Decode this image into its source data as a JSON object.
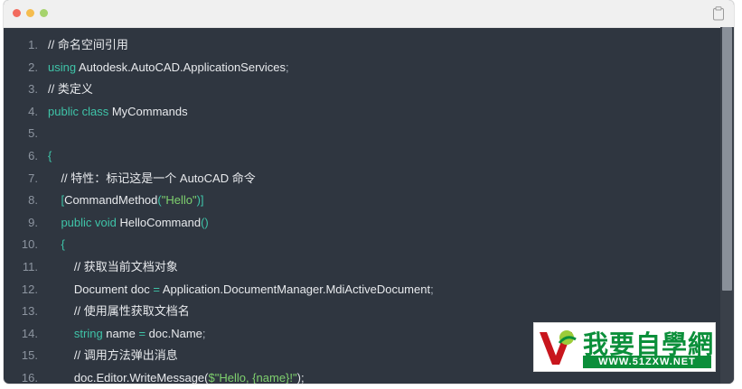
{
  "window": {
    "controls": [
      "close",
      "minimize",
      "maximize"
    ],
    "copy_icon": "clipboard-icon"
  },
  "code": {
    "lines": [
      {
        "n": "1.",
        "parts": [
          {
            "t": "// 命名空间引用",
            "c": "cm"
          }
        ]
      },
      {
        "n": "2.",
        "parts": [
          {
            "t": "using",
            "c": "kw"
          },
          {
            "t": " Autodesk.AutoCAD.ApplicationServices",
            "c": ""
          },
          {
            "t": ";",
            "c": "punc"
          }
        ]
      },
      {
        "n": "3.",
        "parts": [
          {
            "t": "// 类定义",
            "c": "cm"
          }
        ]
      },
      {
        "n": "4.",
        "parts": [
          {
            "t": "public class",
            "c": "kw"
          },
          {
            "t": " MyCommands",
            "c": ""
          }
        ]
      },
      {
        "n": "5.",
        "parts": []
      },
      {
        "n": "6.",
        "parts": [
          {
            "t": "{",
            "c": "kw"
          }
        ]
      },
      {
        "n": "7.",
        "parts": [
          {
            "t": "    // 特性：标记这是一个 AutoCAD 命令",
            "c": "cm"
          }
        ]
      },
      {
        "n": "8.",
        "parts": [
          {
            "t": "    [",
            "c": "kw"
          },
          {
            "t": "CommandMethod",
            "c": ""
          },
          {
            "t": "(",
            "c": "kw"
          },
          {
            "t": "\"Hello\"",
            "c": "str"
          },
          {
            "t": ")]",
            "c": "kw"
          }
        ]
      },
      {
        "n": "9.",
        "parts": [
          {
            "t": "    public void",
            "c": "kw"
          },
          {
            "t": " HelloCommand",
            "c": ""
          },
          {
            "t": "()",
            "c": "kw"
          }
        ]
      },
      {
        "n": "10.",
        "parts": [
          {
            "t": "    {",
            "c": "kw"
          }
        ]
      },
      {
        "n": "11.",
        "parts": [
          {
            "t": "        // 获取当前文档对象",
            "c": "cm"
          }
        ]
      },
      {
        "n": "12.",
        "parts": [
          {
            "t": "        Document doc ",
            "c": ""
          },
          {
            "t": "=",
            "c": "kw"
          },
          {
            "t": " Application.DocumentManager.MdiActiveDocument",
            "c": ""
          },
          {
            "t": ";",
            "c": "punc"
          }
        ]
      },
      {
        "n": "13.",
        "parts": [
          {
            "t": "        // 使用属性获取文档名",
            "c": "cm"
          }
        ]
      },
      {
        "n": "14.",
        "parts": [
          {
            "t": "        string",
            "c": "kw"
          },
          {
            "t": " name ",
            "c": ""
          },
          {
            "t": "=",
            "c": "kw"
          },
          {
            "t": " doc.Name",
            "c": ""
          },
          {
            "t": ";",
            "c": "punc"
          }
        ]
      },
      {
        "n": "15.",
        "parts": [
          {
            "t": "        // 调用方法弹出消息",
            "c": "cm"
          }
        ]
      },
      {
        "n": "16.",
        "parts": [
          {
            "t": "        doc.Editor.WriteMessage(",
            "c": ""
          },
          {
            "t": "$\"Hello, {name}!\"",
            "c": "str"
          },
          {
            "t": ");",
            "c": ""
          }
        ]
      }
    ]
  },
  "watermark": {
    "title": "我要自學網",
    "url": "WWW.51ZXW.NET"
  }
}
